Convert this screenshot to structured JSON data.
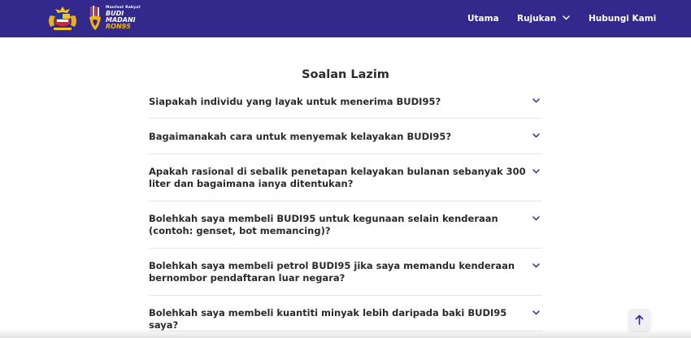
{
  "header": {
    "brand_color": "#33288c",
    "logo": {
      "tagline": "Manfaat Rakyat",
      "line1": "BUDI",
      "line2": "MADANI",
      "line3": "RON95"
    },
    "nav": {
      "home": "Utama",
      "references": "Rujukan",
      "contact": "Hubungi Kami"
    }
  },
  "faq": {
    "title": "Soalan Lazim",
    "items": [
      {
        "question": "Siapakah individu yang layak untuk menerima BUDI95?"
      },
      {
        "question": "Bagaimanakah cara untuk menyemak kelayakan BUDI95?"
      },
      {
        "question": "Apakah rasional di sebalik penetapan kelayakan bulanan sebanyak 300 liter dan bagaimana ianya ditentukan?"
      },
      {
        "question": "Bolehkah saya membeli BUDI95 untuk kegunaan selain kenderaan (contoh: genset, bot memancing)?"
      },
      {
        "question": "Bolehkah saya membeli petrol BUDI95 jika saya memandu kenderaan bernombor pendaftaran luar negara?"
      },
      {
        "question": "Bolehkah saya membeli kuantiti minyak lebih daripada baki BUDI95 saya?"
      }
    ]
  },
  "icons": {
    "expand": "chevron-down-icon",
    "scroll_top": "arrow-up-icon",
    "crest": "coat-of-arms-icon"
  }
}
